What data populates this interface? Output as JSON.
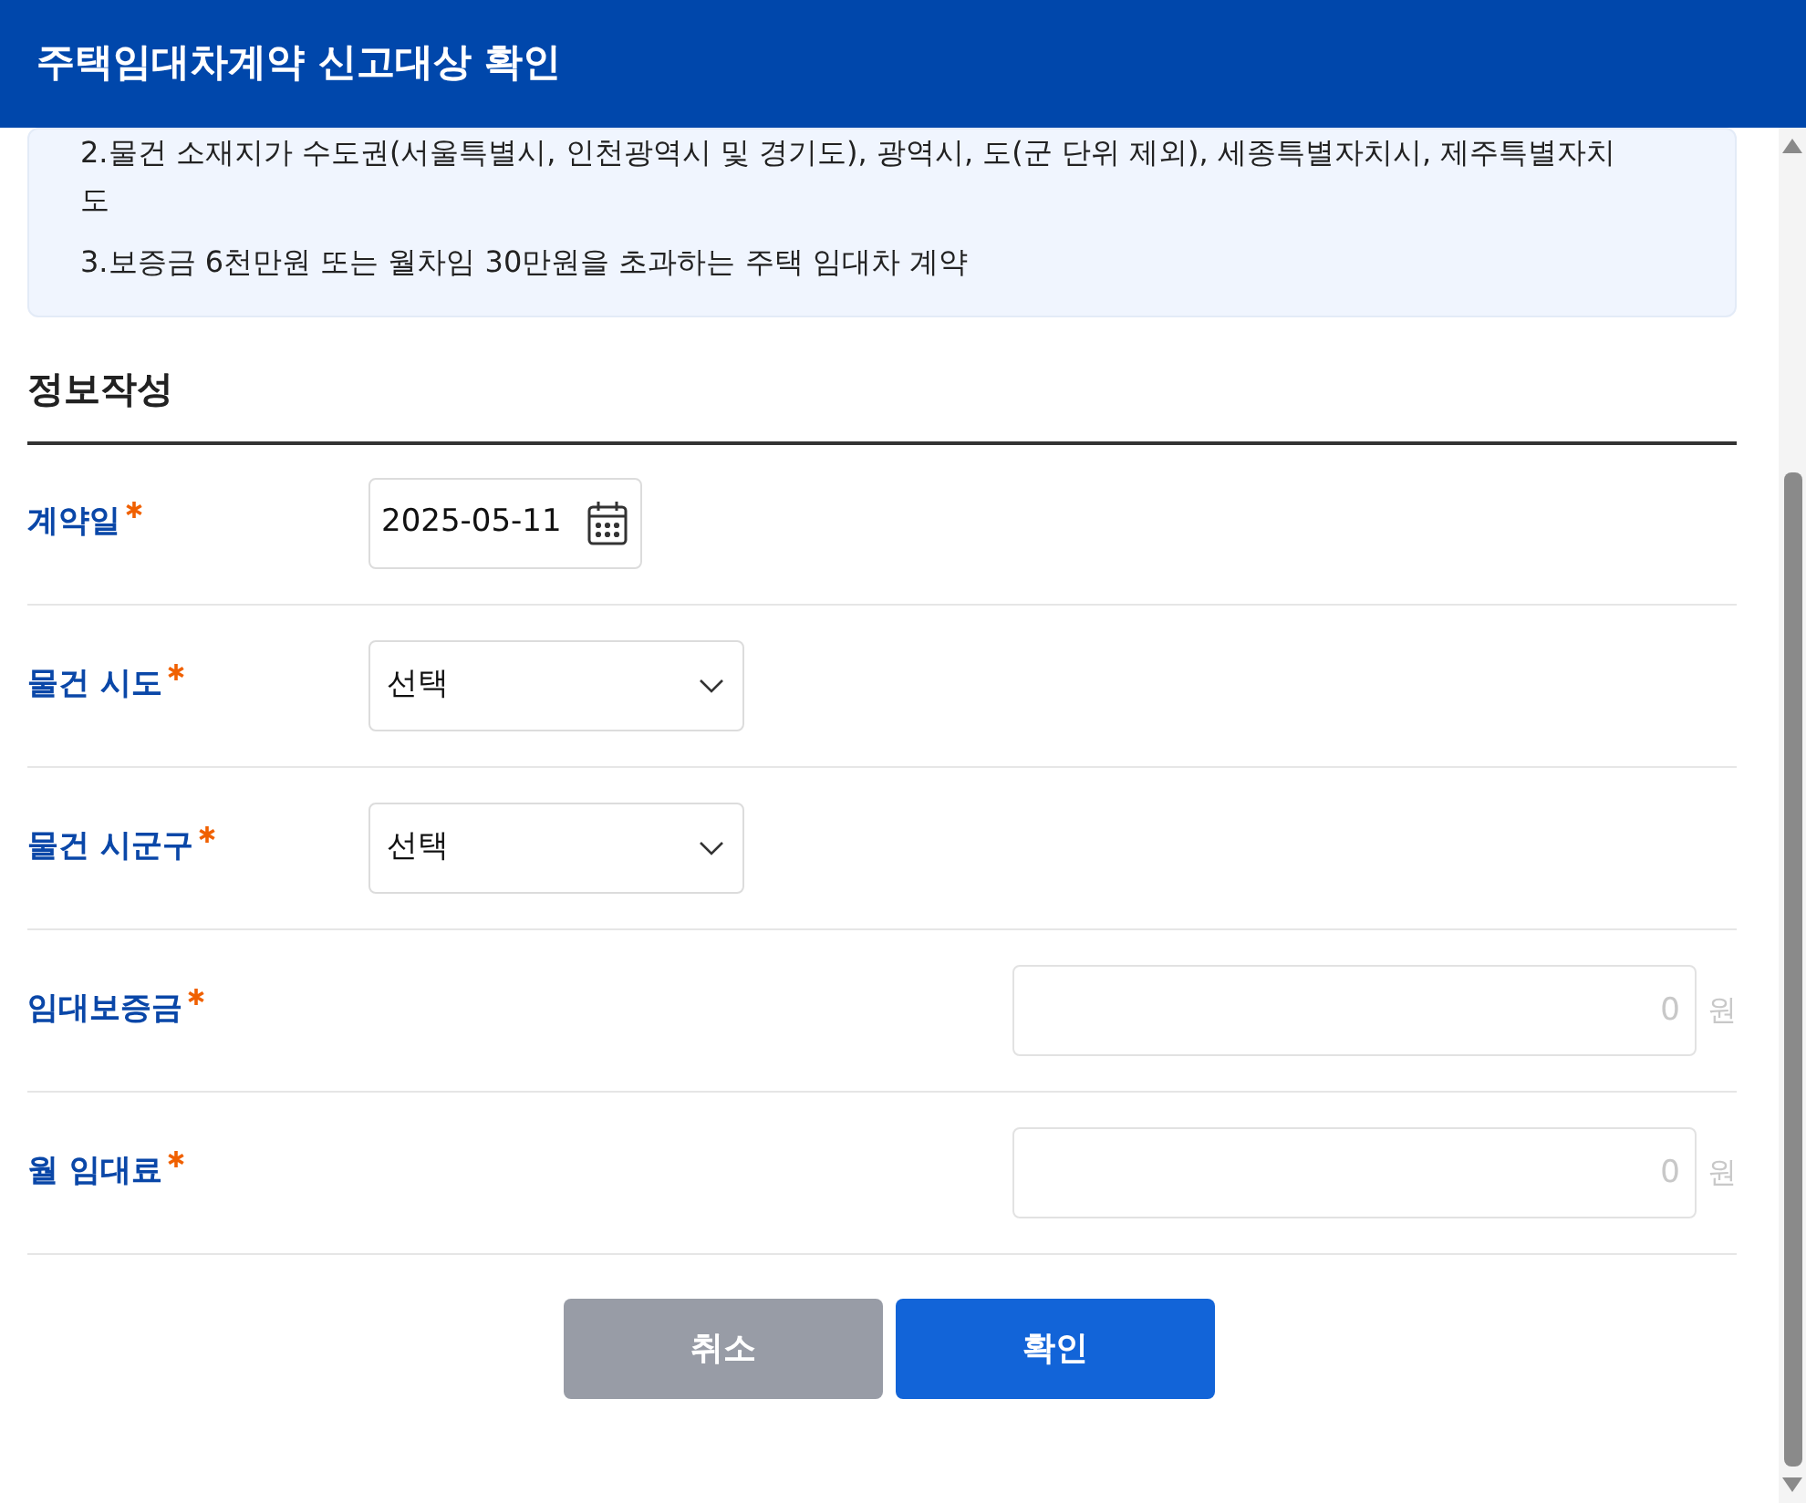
{
  "dialog": {
    "title": "주택임대차계약 신고대상 확인"
  },
  "notice": [
    "2.물건 소재지가 수도권(서울특별시, 인천광역시 및 경기도), 광역시, 도(군 단위 제외), 세종특별자치시, 제주특별자치도",
    "3.보증금 6천만원 또는 월차임 30만원을 초과하는 주택 임대차 계약"
  ],
  "section": {
    "title": "정보작성"
  },
  "fields": [
    {
      "kind": "date",
      "label": "계약일",
      "required": true,
      "value": "2025-05-11"
    },
    {
      "kind": "select",
      "label": "물건 시도",
      "required": true,
      "value": "선택"
    },
    {
      "kind": "select",
      "label": "물건 시군구",
      "required": true,
      "value": "선택"
    },
    {
      "kind": "amount",
      "label": "임대보증금",
      "required": true,
      "placeholder": "0",
      "unit": "원"
    },
    {
      "kind": "amount",
      "label": "월 임대료",
      "required": true,
      "placeholder": "0",
      "unit": "원"
    }
  ],
  "buttons": [
    {
      "kind": "cancel",
      "label": "취소"
    },
    {
      "kind": "confirm",
      "label": "확인"
    }
  ]
}
